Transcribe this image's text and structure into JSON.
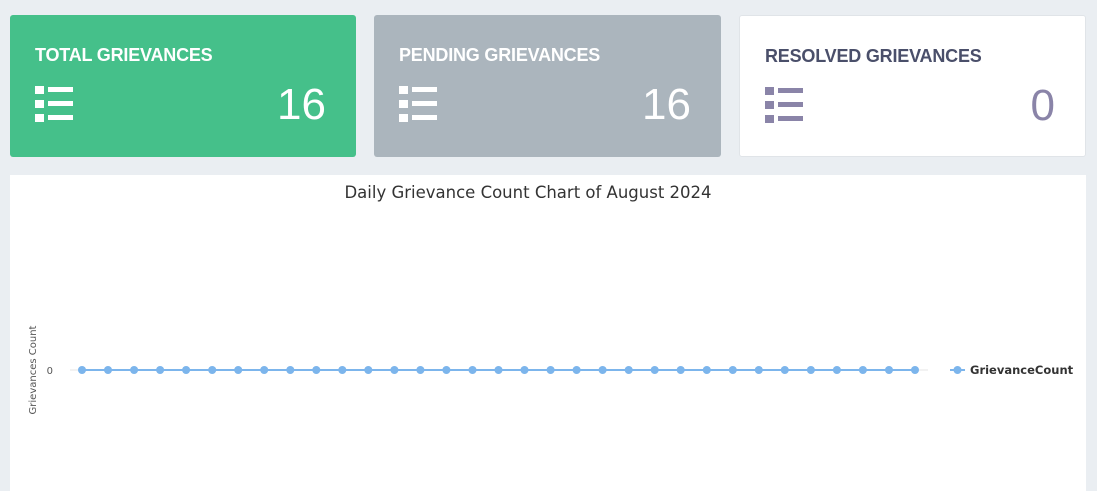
{
  "cards": [
    {
      "title": "TOTAL GRIEVANCES",
      "count": "16",
      "icon": "list-icon",
      "color": "#45c08a"
    },
    {
      "title": "PENDING GRIEVANCES",
      "count": "16",
      "icon": "list-icon",
      "color": "#abb5bd"
    },
    {
      "title": "RESOLVED GRIEVANCES",
      "count": "0",
      "icon": "list-icon",
      "color": "#ffffff"
    }
  ],
  "chart_data": {
    "type": "line",
    "title": "Daily Grievance Count Chart of August 2024",
    "ylabel": "Grievances Count",
    "xlabel": "",
    "y_ticks": [
      "0"
    ],
    "series": [
      {
        "name": "GrievanceCount",
        "color": "#7cb5ec",
        "values": [
          0,
          0,
          0,
          0,
          0,
          0,
          0,
          0,
          0,
          0,
          0,
          0,
          0,
          0,
          0,
          0,
          0,
          0,
          0,
          0,
          0,
          0,
          0,
          0,
          0,
          0,
          0,
          0,
          0,
          0,
          0,
          0,
          0
        ]
      }
    ],
    "grid": false,
    "legend": "right"
  }
}
